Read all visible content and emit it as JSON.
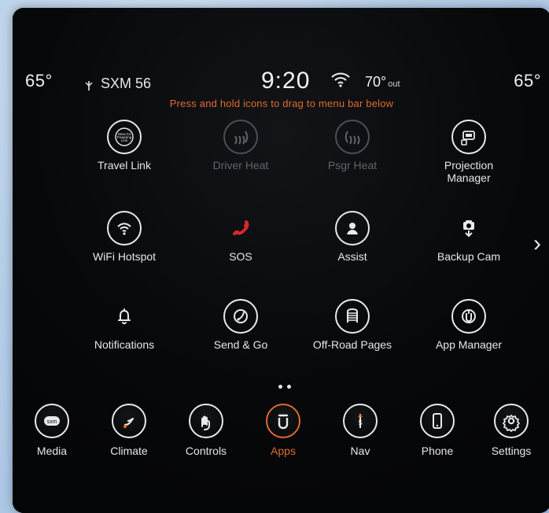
{
  "status": {
    "temp_left": "65°",
    "sxm_label": "SXM 56",
    "time": "9:20",
    "outside_temp": "70°",
    "outside_label": "out",
    "temp_right": "65°"
  },
  "hint": "Press and hold icons to drag to menu bar below",
  "apps": [
    {
      "label": "Travel Link",
      "icon": "travel-link-icon"
    },
    {
      "label": "Driver Heat",
      "icon": "driver-heat-icon"
    },
    {
      "label": "Psgr Heat",
      "icon": "passenger-heat-icon"
    },
    {
      "label": "Projection\nManager",
      "icon": "projection-manager-icon"
    },
    {
      "label": "WiFi Hotspot",
      "icon": "wifi-hotspot-icon"
    },
    {
      "label": "SOS",
      "icon": "sos-icon"
    },
    {
      "label": "Assist",
      "icon": "assist-icon"
    },
    {
      "label": "Backup Cam",
      "icon": "backup-cam-icon"
    },
    {
      "label": "Notifications",
      "icon": "notifications-icon"
    },
    {
      "label": "Send & Go",
      "icon": "send-go-icon"
    },
    {
      "label": "Off-Road Pages",
      "icon": "off-road-pages-icon"
    },
    {
      "label": "App Manager",
      "icon": "app-manager-icon"
    }
  ],
  "bottom_tabs": [
    {
      "label": "Media",
      "icon": "media-icon"
    },
    {
      "label": "Climate",
      "icon": "climate-icon"
    },
    {
      "label": "Controls",
      "icon": "controls-icon"
    },
    {
      "label": "Apps",
      "icon": "apps-icon",
      "active": true
    },
    {
      "label": "Nav",
      "icon": "nav-icon"
    },
    {
      "label": "Phone",
      "icon": "phone-icon"
    },
    {
      "label": "Settings",
      "icon": "settings-icon"
    }
  ],
  "colors": {
    "accent": "#e06b2a",
    "sos_red": "#d9272e"
  },
  "media_badge": "sxm",
  "travel_link_badge": "Drive for\nPowering\nLink"
}
